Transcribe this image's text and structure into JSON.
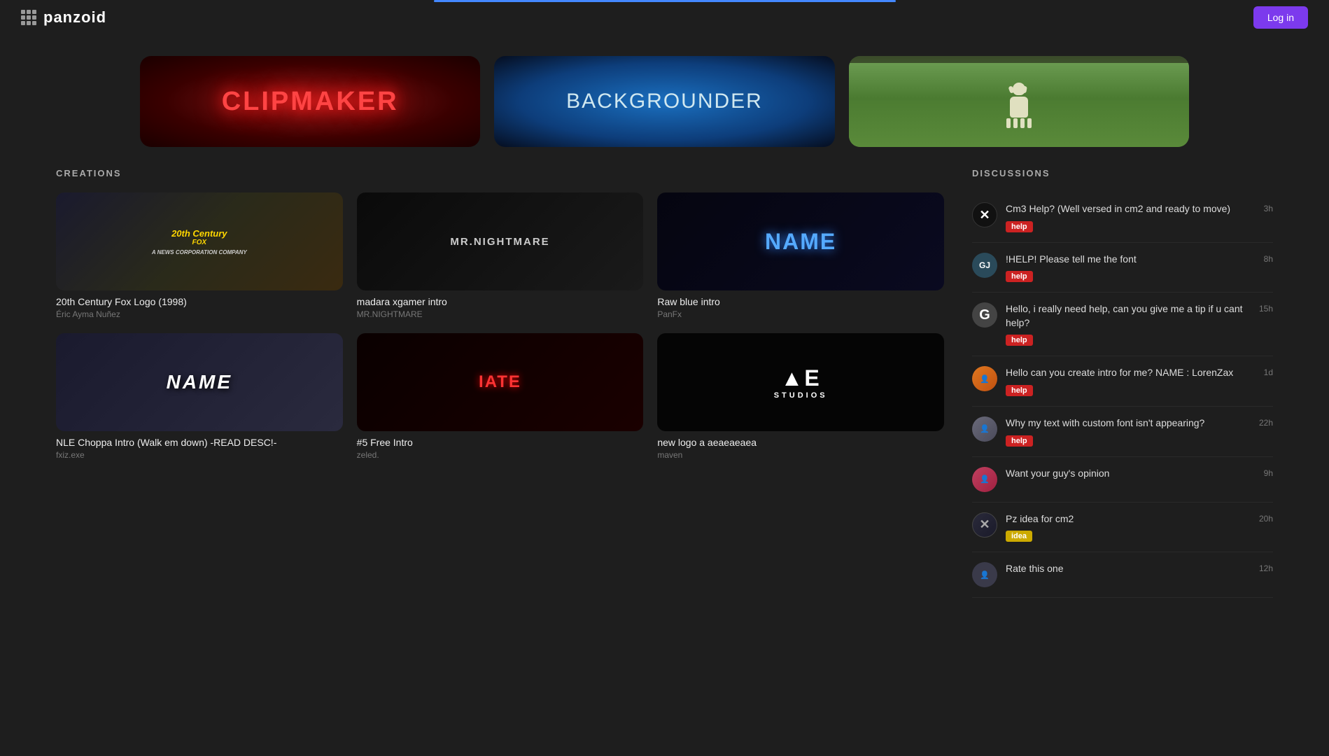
{
  "header": {
    "logo": "panzoid",
    "login_label": "Log in"
  },
  "hero": {
    "cards": [
      {
        "id": "clipmaker",
        "label": "CLIPMAKER"
      },
      {
        "id": "backgrounder",
        "label": "BACKGROUNDER"
      },
      {
        "id": "photo",
        "label": ""
      }
    ]
  },
  "creations": {
    "section_title": "CREATIONS",
    "items": [
      {
        "title": "20th Century Fox Logo (1998)",
        "author": "Éric Ayma Nuñez",
        "thumb_text": "20th Century Fox",
        "thumb_class": "thumb-fox"
      },
      {
        "title": "madara xgamer intro",
        "author": "MR.NIGHTMARE",
        "thumb_text": "MR.NIGHTMARE",
        "thumb_class": "thumb-mrnightmare"
      },
      {
        "title": "Raw blue intro",
        "author": "PanFx",
        "thumb_text": "NAME",
        "thumb_class": "thumb-rawblue"
      },
      {
        "title": "NLE Choppa Intro (Walk em down) -READ DESC!-",
        "author": "fxiz.exe",
        "thumb_text": "NAME",
        "thumb_class": "thumb-nle"
      },
      {
        "title": "#5 Free Intro",
        "author": "zeled.",
        "thumb_text": "IATE",
        "thumb_class": "thumb-5free"
      },
      {
        "title": "new logo a aeaeaeaea",
        "author": "maven",
        "thumb_text": "AE",
        "thumb_class": "thumb-logo"
      }
    ]
  },
  "discussions": {
    "section_title": "DISCUSSIONS",
    "items": [
      {
        "avatar_type": "x",
        "title": "Cm3 Help? (Well versed in cm2 and ready to move)",
        "tag": "help",
        "tag_type": "help",
        "time": "3h"
      },
      {
        "avatar_type": "g1",
        "title": "!HELP! Please tell me the font",
        "tag": "help",
        "tag_type": "help",
        "time": "8h"
      },
      {
        "avatar_type": "g",
        "title": "Hello, i really need help, can you give me a tip if u cant help?",
        "tag": "help",
        "tag_type": "help",
        "time": "15h"
      },
      {
        "avatar_type": "orange",
        "title": "Hello can you create intro for me? NAME : LorenZax",
        "tag": "help",
        "tag_type": "help",
        "time": "1d"
      },
      {
        "avatar_type": "person",
        "title": "Why my text with custom font isn't appearing?",
        "tag": "help",
        "tag_type": "help",
        "time": "22h"
      },
      {
        "avatar_type": "pink",
        "title": "Want your guy's opinion",
        "tag": null,
        "tag_type": null,
        "time": "9h"
      },
      {
        "avatar_type": "dark",
        "title": "Pz idea for cm2",
        "tag": "idea",
        "tag_type": "idea",
        "time": "20h"
      },
      {
        "avatar_type": "grey",
        "title": "Rate this one",
        "tag": null,
        "tag_type": null,
        "time": "12h"
      }
    ]
  }
}
